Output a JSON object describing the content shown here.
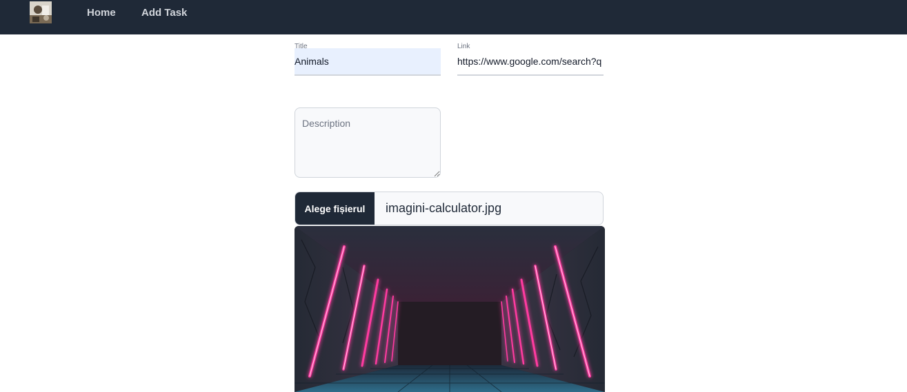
{
  "navbar": {
    "logo_icon": "avatar-thumbnail",
    "links": [
      {
        "label": "Home"
      },
      {
        "label": "Add Task"
      }
    ],
    "background": "#1f2937"
  },
  "form": {
    "title": {
      "label": "Title",
      "value": "Animals"
    },
    "link": {
      "label": "Link",
      "value": "https://www.google.com/search?q"
    },
    "description": {
      "placeholder": "Description",
      "value": ""
    },
    "file": {
      "button_label": "Alege fișierul",
      "file_name": "imagini-calculator.jpg"
    }
  },
  "preview": {
    "subject": "neon-lit corridor image",
    "accent_color": "#ff2d95"
  }
}
